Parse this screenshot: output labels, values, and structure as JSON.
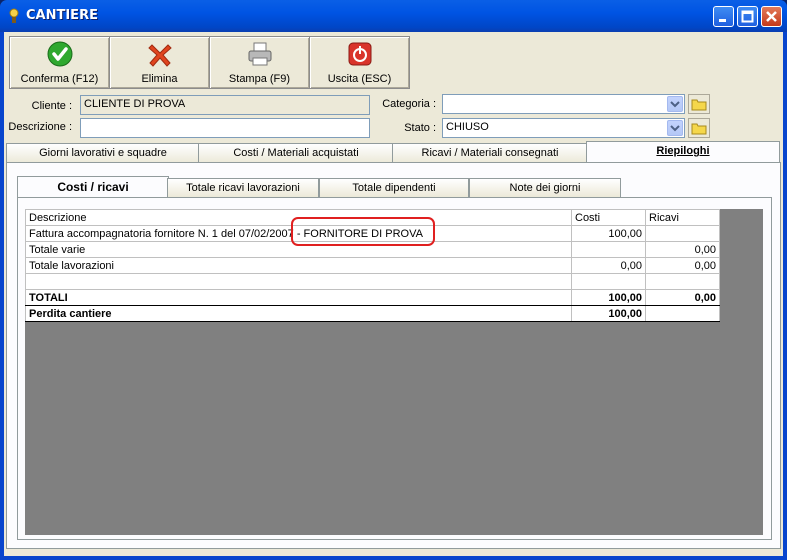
{
  "window": {
    "title": "CANTIERE"
  },
  "toolbar": [
    {
      "label": "Conferma (F12)",
      "icon": "check-icon"
    },
    {
      "label": "Elimina",
      "icon": "delete-x-icon"
    },
    {
      "label": "Stampa (F9)",
      "icon": "printer-icon"
    },
    {
      "label": "Uscita (ESC)",
      "icon": "power-exit-icon"
    }
  ],
  "form": {
    "cliente_label": "Cliente :",
    "cliente_value": "CLIENTE DI PROVA",
    "descrizione_label": "Descrizione :",
    "descrizione_value": "",
    "categoria_label": "Categoria :",
    "categoria_value": "",
    "stato_label": "Stato :",
    "stato_value": "CHIUSO"
  },
  "tabs": [
    {
      "label": "Giorni lavorativi e squadre"
    },
    {
      "label": "Costi / Materiali acquistati"
    },
    {
      "label": "Ricavi / Materiali consegnati"
    },
    {
      "label": "Riepiloghi",
      "active": true
    }
  ],
  "subtabs": [
    {
      "label": "Costi / ricavi",
      "active": true
    },
    {
      "label": "Totale ricavi lavorazioni"
    },
    {
      "label": "Totale dipendenti"
    },
    {
      "label": "Note dei giorni"
    }
  ],
  "grid": {
    "headers": [
      "Descrizione",
      "Costi",
      "Ricavi"
    ],
    "rows": [
      [
        "Fattura accompagnatoria fornitore N. 1 del 07/02/2007 - FORNITORE DI PROVA",
        "100,00",
        ""
      ],
      [
        "Totale varie",
        "",
        "0,00"
      ],
      [
        "Totale lavorazioni",
        "0,00",
        "0,00"
      ],
      [
        "",
        "",
        ""
      ],
      [
        "TOTALI",
        "100,00",
        "0,00"
      ],
      [
        "Perdita cantiere",
        "100,00",
        ""
      ]
    ]
  },
  "colors": {
    "titlebar": "#0054e3",
    "highlight": "#e02020",
    "grid_bg": "#808080"
  }
}
